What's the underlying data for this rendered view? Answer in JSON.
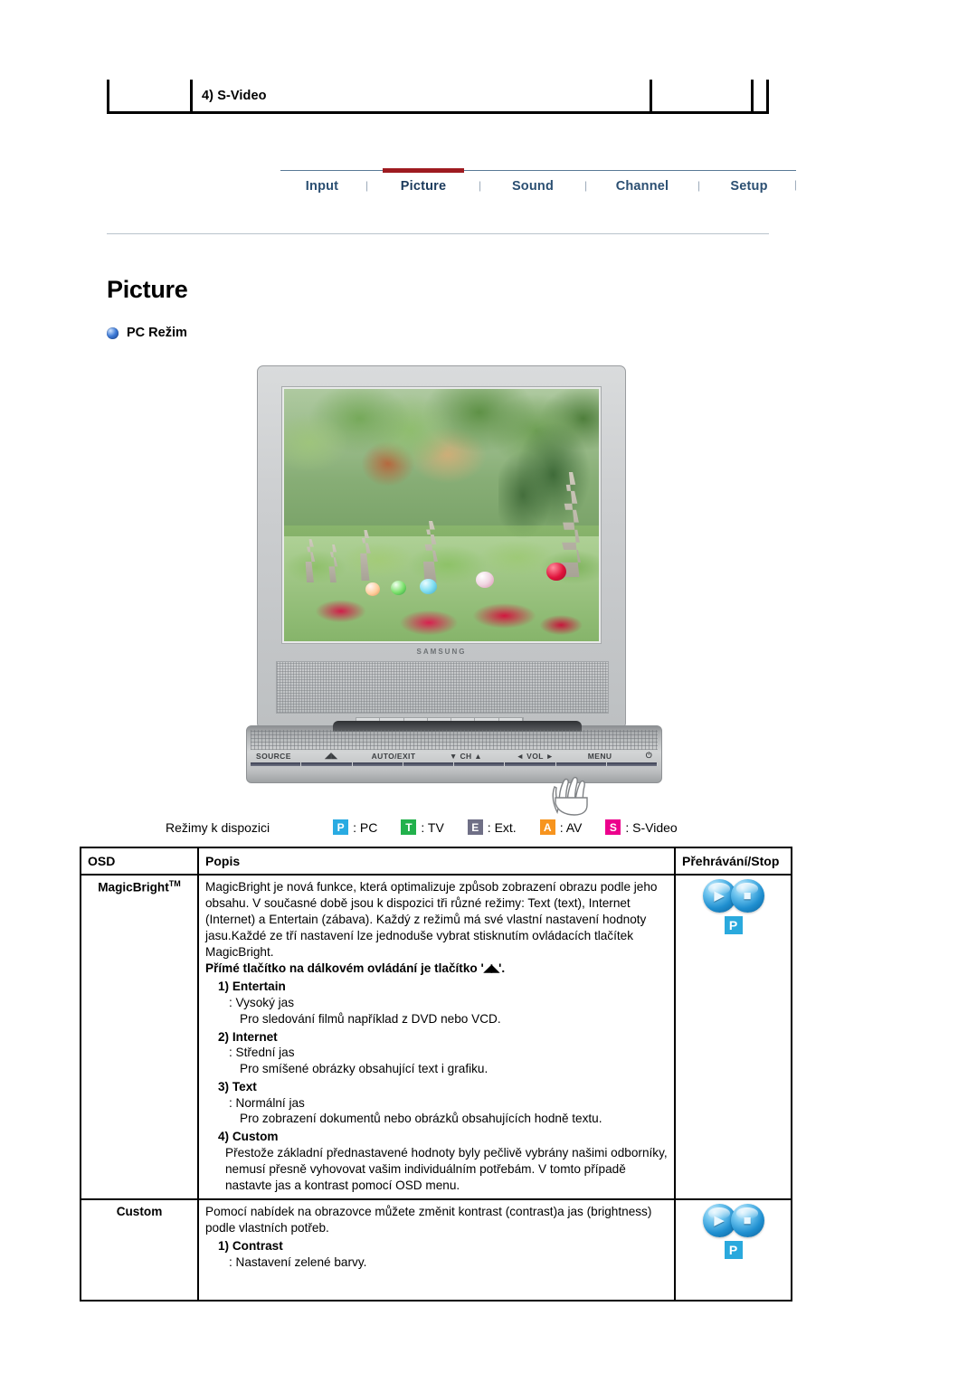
{
  "top_fragment": {
    "cells": [
      "",
      "4) S-Video",
      "",
      ""
    ]
  },
  "nav": {
    "items": [
      {
        "label": "Input",
        "active": false
      },
      {
        "label": "Picture",
        "active": true
      },
      {
        "label": "Sound",
        "active": false
      },
      {
        "label": "Channel",
        "active": false
      },
      {
        "label": "Setup",
        "active": false
      }
    ],
    "separator": "|",
    "active_color": "#9e1b20",
    "link_color": "#2b4f72"
  },
  "page": {
    "title": "Picture",
    "section_heading": "PC Režim",
    "bullet_icon": "blue-sphere-bullet-icon"
  },
  "monitor": {
    "brand": "SAMSUNG",
    "screen_image_alt": "korean-garden-pagoda-photo",
    "controls": [
      "SOURCE",
      "magicbright-icon",
      "AUTO/EXIT",
      "▼ CH ▲",
      "◄ VOL ►",
      "MENU",
      "⏻"
    ],
    "hand_icon": "pointing-hand-icon"
  },
  "legend": {
    "label": "Režimy k dispozici",
    "items": [
      {
        "badge": "P",
        "color": "#29abe2",
        "text": ": PC"
      },
      {
        "badge": "T",
        "color": "#22b14c",
        "text": ": TV"
      },
      {
        "badge": "E",
        "color": "#6f6f86",
        "text": ": Ext."
      },
      {
        "badge": "A",
        "color": "#f7941e",
        "text": ": AV"
      },
      {
        "badge": "S",
        "color": "#ec008c",
        "text": ": S-Video"
      }
    ]
  },
  "table": {
    "headers": {
      "osd": "OSD",
      "desc": "Popis",
      "play": "Přehrávání/Stop"
    },
    "rows": [
      {
        "osd_name": "MagicBright",
        "osd_sup": "TM",
        "paragraph": "MagicBright je nová funkce, která optimalizuje způsob zobrazení obrazu podle jeho obsahu. V současné době jsou k dispozici tři různé režimy: Text (text), Internet (Internet) a Entertain (zábava). Každý z režimů má své vlastní nastavení hodnoty jasu.Každé ze tří nastavení lze jednoduše vybrat stisknutím ovládacích tlačítek MagicBright.",
        "bold_line_pre": "Přímé tlačítko na dálkovém ovládání je tlačítko '",
        "bold_line_glyph": "◢◣",
        "bold_line_post": "'.",
        "items": [
          {
            "num": "1) Entertain",
            "colon_line": ": Vysoký jas",
            "plain_line": "Pro sledování filmů například z DVD nebo VCD."
          },
          {
            "num": "2) Internet",
            "colon_line": ": Střední jas",
            "plain_line": "Pro smíšené obrázky obsahující text i grafiku."
          },
          {
            "num": "3) Text",
            "colon_line": ": Normální jas",
            "plain_line": "Pro zobrazení dokumentů nebo obrázků obsahujících hodně textu."
          },
          {
            "num": "4) Custom",
            "colon_line": "",
            "plain_line": "Přestože základní přednastavené hodnoty byly pečlivě vybrány našimi odborníky, nemusí přesně vyhovovat vašim individuálním potřebám. V tomto případě nastavte jas a kontrast pomocí OSD menu."
          }
        ],
        "play_icons": {
          "play": "play-orb-icon",
          "stop": "stop-orb-icon",
          "badge": "P"
        }
      },
      {
        "osd_name": "Custom",
        "osd_sup": "",
        "paragraph": "Pomocí nabídek na obrazovce můžete změnit kontrast (contrast)a jas (brightness) podle vlastních potřeb.",
        "items": [
          {
            "num": "1) Contrast",
            "colon_line": ": Nastavení zelené barvy.",
            "plain_line": ""
          }
        ],
        "play_icons": {
          "play": "play-orb-icon",
          "stop": "stop-orb-icon",
          "badge": "P"
        }
      }
    ]
  }
}
